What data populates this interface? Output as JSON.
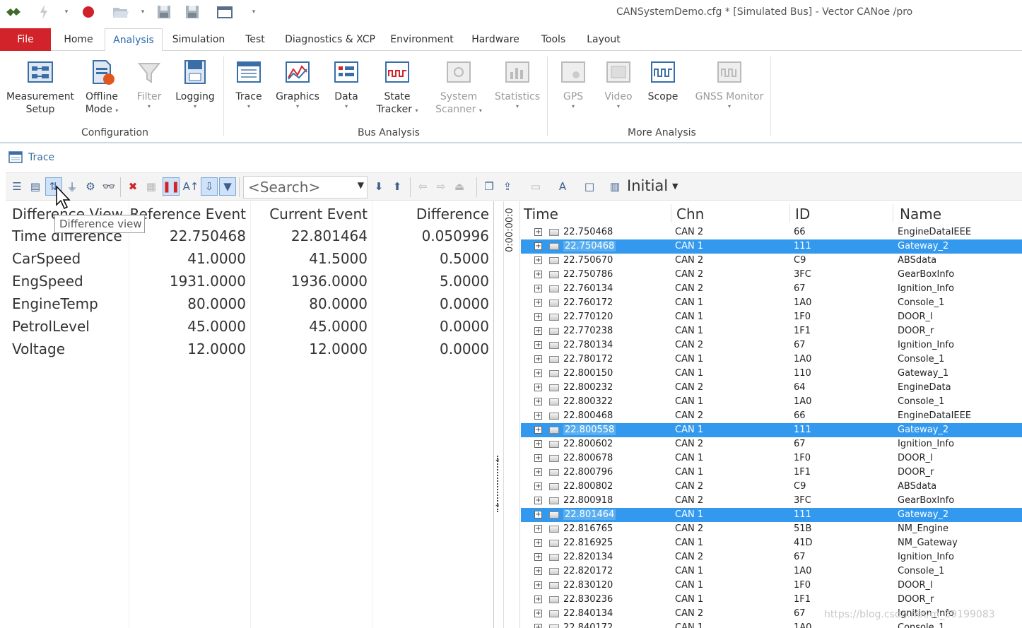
{
  "window": {
    "title": "CANSystemDemo.cfg * [Simulated Bus] - Vector CANoe /pro",
    "quick_access": [
      "app-logo-icon",
      "lightning-icon",
      "dropdown-icon",
      "record-icon",
      "open-folder-icon",
      "dropdown-icon",
      "save-icon",
      "save-as-icon",
      "options-icon",
      "customize-icon"
    ]
  },
  "menu": {
    "tabs": [
      "File",
      "Home",
      "Analysis",
      "Simulation",
      "Test",
      "Diagnostics & XCP",
      "Environment",
      "Hardware",
      "Tools",
      "Layout"
    ],
    "active": "Analysis"
  },
  "ribbon": {
    "buttons": [
      {
        "line1": "Measurement",
        "line2": "Setup",
        "arrow": "",
        "enabled": true,
        "icon": "measurement-setup-icon"
      },
      {
        "line1": "Offline",
        "line2": "Mode",
        "arrow": "▾",
        "enabled": true,
        "icon": "offline-mode-icon"
      },
      {
        "line1": "Filter",
        "line2": "",
        "arrow": "▾",
        "enabled": false,
        "icon": "filter-icon"
      },
      {
        "line1": "Logging",
        "line2": "",
        "arrow": "▾",
        "enabled": true,
        "icon": "logging-icon"
      },
      {
        "line1": "Trace",
        "line2": "",
        "arrow": "▾",
        "enabled": true,
        "icon": "trace-icon"
      },
      {
        "line1": "Graphics",
        "line2": "",
        "arrow": "▾",
        "enabled": true,
        "icon": "graphics-icon"
      },
      {
        "line1": "Data",
        "line2": "",
        "arrow": "▾",
        "enabled": true,
        "icon": "data-icon"
      },
      {
        "line1": "State",
        "line2": "Tracker",
        "arrow": "▾",
        "enabled": true,
        "icon": "state-tracker-icon"
      },
      {
        "line1": "System",
        "line2": "Scanner",
        "arrow": "▾",
        "enabled": false,
        "icon": "system-scanner-icon"
      },
      {
        "line1": "Statistics",
        "line2": "",
        "arrow": "▾",
        "enabled": false,
        "icon": "statistics-icon"
      },
      {
        "line1": "GPS",
        "line2": "",
        "arrow": "▾",
        "enabled": false,
        "icon": "gps-icon"
      },
      {
        "line1": "Video",
        "line2": "",
        "arrow": "▾",
        "enabled": false,
        "icon": "video-icon"
      },
      {
        "line1": "Scope",
        "line2": "",
        "arrow": "",
        "enabled": true,
        "icon": "scope-icon"
      },
      {
        "line1": "GNSS Monitor",
        "line2": "",
        "arrow": "▾",
        "enabled": false,
        "icon": "gnss-monitor-icon"
      }
    ],
    "groups": [
      "Configuration",
      "Bus Analysis",
      "More Analysis"
    ]
  },
  "trace_window": {
    "title": "Trace",
    "search_placeholder": "<Search>",
    "initial_label": "Initial",
    "tooltip": "Difference view"
  },
  "diff_view": {
    "headers": [
      "Difference View",
      "Reference Event",
      "Current Event",
      "Difference"
    ],
    "rows": [
      {
        "name": "Time difference",
        "ref": "22.750468",
        "cur": "22.801464",
        "diff": "0.050996"
      },
      {
        "name": "CarSpeed",
        "ref": "41.0000",
        "cur": "41.5000",
        "diff": "0.5000"
      },
      {
        "name": "EngSpeed",
        "ref": "1931.0000",
        "cur": "1936.0000",
        "diff": "5.0000"
      },
      {
        "name": "EngineTemp",
        "ref": "80.0000",
        "cur": "80.0000",
        "diff": "0.0000"
      },
      {
        "name": "PetrolLevel",
        "ref": "45.0000",
        "cur": "45.0000",
        "diff": "0.0000"
      },
      {
        "name": "Voltage",
        "ref": "12.0000",
        "cur": "12.0000",
        "diff": "0.0000"
      }
    ]
  },
  "time_scale": "0:00:00:0",
  "trace_list": {
    "headers": [
      "Time",
      "Chn",
      "ID",
      "Name"
    ],
    "rows": [
      {
        "time": "22.750468",
        "chn": "CAN 2",
        "id": "66",
        "name": "EngineDataIEEE",
        "selected": false
      },
      {
        "time": "22.750468",
        "chn": "CAN 1",
        "id": "111",
        "name": "Gateway_2",
        "selected": true
      },
      {
        "time": "22.750670",
        "chn": "CAN 2",
        "id": "C9",
        "name": "ABSdata",
        "selected": false
      },
      {
        "time": "22.750786",
        "chn": "CAN 2",
        "id": "3FC",
        "name": "GearBoxInfo",
        "selected": false
      },
      {
        "time": "22.760134",
        "chn": "CAN 2",
        "id": "67",
        "name": "Ignition_Info",
        "selected": false
      },
      {
        "time": "22.760172",
        "chn": "CAN 1",
        "id": "1A0",
        "name": "Console_1",
        "selected": false
      },
      {
        "time": "22.770120",
        "chn": "CAN 1",
        "id": "1F0",
        "name": "DOOR_l",
        "selected": false
      },
      {
        "time": "22.770238",
        "chn": "CAN 1",
        "id": "1F1",
        "name": "DOOR_r",
        "selected": false
      },
      {
        "time": "22.780134",
        "chn": "CAN 2",
        "id": "67",
        "name": "Ignition_Info",
        "selected": false
      },
      {
        "time": "22.780172",
        "chn": "CAN 1",
        "id": "1A0",
        "name": "Console_1",
        "selected": false
      },
      {
        "time": "22.800150",
        "chn": "CAN 1",
        "id": "110",
        "name": "Gateway_1",
        "selected": false
      },
      {
        "time": "22.800232",
        "chn": "CAN 2",
        "id": "64",
        "name": "EngineData",
        "selected": false
      },
      {
        "time": "22.800322",
        "chn": "CAN 1",
        "id": "1A0",
        "name": "Console_1",
        "selected": false
      },
      {
        "time": "22.800468",
        "chn": "CAN 2",
        "id": "66",
        "name": "EngineDataIEEE",
        "selected": false
      },
      {
        "time": "22.800558",
        "chn": "CAN 1",
        "id": "111",
        "name": "Gateway_2",
        "selected": true
      },
      {
        "time": "22.800602",
        "chn": "CAN 2",
        "id": "67",
        "name": "Ignition_Info",
        "selected": false
      },
      {
        "time": "22.800678",
        "chn": "CAN 1",
        "id": "1F0",
        "name": "DOOR_l",
        "selected": false
      },
      {
        "time": "22.800796",
        "chn": "CAN 1",
        "id": "1F1",
        "name": "DOOR_r",
        "selected": false
      },
      {
        "time": "22.800802",
        "chn": "CAN 2",
        "id": "C9",
        "name": "ABSdata",
        "selected": false
      },
      {
        "time": "22.800918",
        "chn": "CAN 2",
        "id": "3FC",
        "name": "GearBoxInfo",
        "selected": false
      },
      {
        "time": "22.801464",
        "chn": "CAN 1",
        "id": "111",
        "name": "Gateway_2",
        "selected": true
      },
      {
        "time": "22.816765",
        "chn": "CAN 2",
        "id": "51B",
        "name": "NM_Engine",
        "selected": false
      },
      {
        "time": "22.816925",
        "chn": "CAN 1",
        "id": "41D",
        "name": "NM_Gateway",
        "selected": false
      },
      {
        "time": "22.820134",
        "chn": "CAN 2",
        "id": "67",
        "name": "Ignition_Info",
        "selected": false
      },
      {
        "time": "22.820172",
        "chn": "CAN 1",
        "id": "1A0",
        "name": "Console_1",
        "selected": false
      },
      {
        "time": "22.830120",
        "chn": "CAN 1",
        "id": "1F0",
        "name": "DOOR_l",
        "selected": false
      },
      {
        "time": "22.830236",
        "chn": "CAN 1",
        "id": "1F1",
        "name": "DOOR_r",
        "selected": false
      },
      {
        "time": "22.840134",
        "chn": "CAN 2",
        "id": "67",
        "name": "Ignition_Info",
        "selected": false
      },
      {
        "time": "22.840172",
        "chn": "CAN 1",
        "id": "1A0",
        "name": "Console_1",
        "selected": false
      }
    ]
  },
  "watermark": "https://blog.csdn.net/m_39199083",
  "colors": {
    "file_tab": "#d2232a",
    "selection": "#3399ee",
    "active_tab_text": "#2a6ab4"
  }
}
